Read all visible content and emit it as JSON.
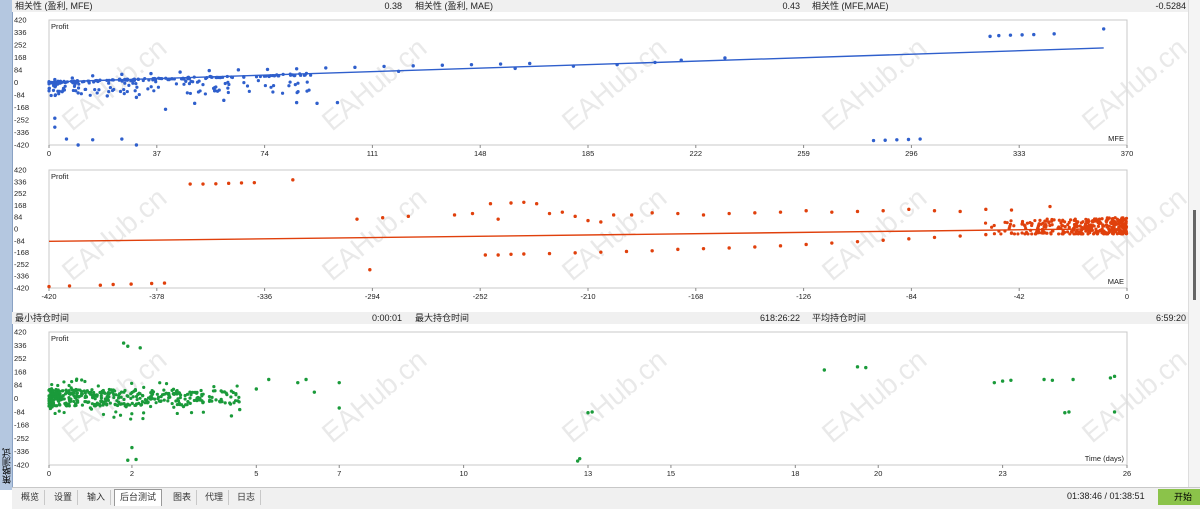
{
  "sidebar": {
    "title": "策略测试"
  },
  "row1": [
    {
      "label": "相关性 (盈利, MFE)",
      "value": "0.38"
    },
    {
      "label": "相关性 (盈利, MAE)",
      "value": "0.43"
    },
    {
      "label": "相关性 (MFE,MAE)",
      "value": "-0.5284"
    }
  ],
  "row2": [
    {
      "label": "最小持仓时间",
      "value": "0:00:01"
    },
    {
      "label": "最大持仓时间",
      "value": "618:26:22"
    },
    {
      "label": "平均持仓时间",
      "value": "6:59:20"
    }
  ],
  "watermark": "EAHub.cn",
  "colors": {
    "mfe": "#2f5fcc",
    "mae": "#e0400c",
    "time": "#1a9a3a"
  },
  "chart_data": [
    {
      "type": "scatter",
      "name": "MFE",
      "ylabel": "Profit",
      "xlabel": "MFE",
      "x_ticks": [
        "0",
        "37",
        "74",
        "111",
        "148",
        "185",
        "222",
        "259",
        "296",
        "333",
        "370"
      ],
      "y_ticks": [
        "420",
        "336",
        "252",
        "168",
        "84",
        "0",
        "-84",
        "-168",
        "-252",
        "-336",
        "-420"
      ],
      "xlim": [
        0,
        370
      ],
      "ylim": [
        -420,
        420
      ],
      "regression": [
        [
          0,
          3
        ],
        [
          362,
          232
        ]
      ],
      "points": [
        [
          120,
          75
        ],
        [
          160,
          95
        ],
        [
          180,
          110
        ],
        [
          195,
          120
        ],
        [
          208,
          135
        ],
        [
          217,
          150
        ],
        [
          232,
          165
        ],
        [
          323,
          310
        ],
        [
          326,
          315
        ],
        [
          330,
          318
        ],
        [
          334,
          320
        ],
        [
          338,
          322
        ],
        [
          345,
          327
        ],
        [
          362,
          360
        ],
        [
          283,
          -390
        ],
        [
          287,
          -388
        ],
        [
          291,
          -385
        ],
        [
          295,
          -383
        ],
        [
          299,
          -380
        ],
        [
          85,
          -135
        ],
        [
          92,
          -140
        ],
        [
          99,
          -135
        ],
        [
          2,
          -240
        ],
        [
          2,
          -300
        ],
        [
          6,
          -380
        ],
        [
          15,
          -385
        ],
        [
          25,
          -380
        ],
        [
          10,
          -420
        ],
        [
          30,
          -420
        ],
        [
          40,
          -180
        ],
        [
          50,
          -140
        ],
        [
          60,
          -120
        ],
        [
          30,
          -100
        ],
        [
          20,
          -90
        ],
        [
          10,
          -70
        ],
        [
          5,
          -40
        ],
        [
          3,
          -10
        ],
        [
          2,
          20
        ],
        [
          8,
          30
        ],
        [
          15,
          45
        ],
        [
          25,
          55
        ],
        [
          35,
          60
        ],
        [
          45,
          70
        ],
        [
          55,
          80
        ],
        [
          65,
          85
        ],
        [
          75,
          88
        ],
        [
          85,
          92
        ],
        [
          95,
          98
        ],
        [
          105,
          102
        ],
        [
          115,
          108
        ],
        [
          125,
          112
        ],
        [
          135,
          116
        ],
        [
          145,
          120
        ],
        [
          155,
          124
        ],
        [
          165,
          128
        ]
      ],
      "dense": {
        "from": 0,
        "to": 90,
        "count": 260
      }
    },
    {
      "type": "scatter",
      "name": "MAE",
      "ylabel": "Profit",
      "xlabel": "MAE",
      "x_ticks": [
        "-420",
        "-378",
        "-336",
        "-294",
        "-252",
        "-210",
        "-168",
        "-126",
        "-84",
        "-42",
        "0"
      ],
      "y_ticks": [
        "420",
        "336",
        "252",
        "168",
        "84",
        "0",
        "-84",
        "-168",
        "-252",
        "-336",
        "-420"
      ],
      "xlim": [
        -420,
        0
      ],
      "ylim": [
        -420,
        420
      ],
      "regression": [
        [
          -420,
          -88
        ],
        [
          -15,
          0
        ]
      ],
      "points": [
        [
          -420,
          -410
        ],
        [
          -412,
          -405
        ],
        [
          -400,
          -400
        ],
        [
          -395,
          -395
        ],
        [
          -388,
          -392
        ],
        [
          -380,
          -388
        ],
        [
          -375,
          -385
        ],
        [
          -365,
          320
        ],
        [
          -360,
          320
        ],
        [
          -355,
          322
        ],
        [
          -350,
          325
        ],
        [
          -345,
          328
        ],
        [
          -340,
          330
        ],
        [
          -325,
          350
        ],
        [
          -300,
          70
        ],
        [
          -290,
          80
        ],
        [
          -280,
          90
        ],
        [
          -262,
          100
        ],
        [
          -255,
          110
        ],
        [
          -248,
          180
        ],
        [
          -245,
          70
        ],
        [
          -240,
          185
        ],
        [
          -235,
          190
        ],
        [
          -230,
          180
        ],
        [
          -225,
          110
        ],
        [
          -220,
          120
        ],
        [
          -215,
          90
        ],
        [
          -210,
          60
        ],
        [
          -205,
          50
        ],
        [
          -200,
          100
        ],
        [
          -193,
          100
        ],
        [
          -185,
          115
        ],
        [
          -175,
          110
        ],
        [
          -165,
          100
        ],
        [
          -155,
          110
        ],
        [
          -145,
          115
        ],
        [
          -135,
          120
        ],
        [
          -125,
          130
        ],
        [
          -115,
          120
        ],
        [
          -105,
          125
        ],
        [
          -95,
          130
        ],
        [
          -85,
          140
        ],
        [
          -75,
          130
        ],
        [
          -65,
          125
        ],
        [
          -55,
          140
        ],
        [
          -45,
          135
        ],
        [
          -30,
          160
        ],
        [
          -295,
          -290
        ],
        [
          -250,
          -185
        ],
        [
          -245,
          -185
        ],
        [
          -240,
          -180
        ],
        [
          -235,
          -178
        ],
        [
          -225,
          -175
        ],
        [
          -215,
          -170
        ],
        [
          -205,
          -165
        ],
        [
          -195,
          -160
        ],
        [
          -185,
          -155
        ],
        [
          -175,
          -145
        ],
        [
          -165,
          -140
        ],
        [
          -155,
          -135
        ],
        [
          -145,
          -128
        ],
        [
          -135,
          -120
        ],
        [
          -125,
          -110
        ],
        [
          -115,
          -100
        ],
        [
          -105,
          -90
        ],
        [
          -95,
          -80
        ],
        [
          -85,
          -70
        ],
        [
          -75,
          -60
        ],
        [
          -65,
          -50
        ],
        [
          -55,
          -40
        ],
        [
          -45,
          -30
        ],
        [
          -35,
          -20
        ]
      ],
      "dense": {
        "from": -60,
        "to": 0,
        "count": 320
      }
    },
    {
      "type": "scatter",
      "name": "Time",
      "ylabel": "Profit",
      "xlabel": "Time (days)",
      "x_ticks": [
        "0",
        "2",
        "5",
        "7",
        "10",
        "13",
        "15",
        "18",
        "20",
        "23",
        "26"
      ],
      "y_ticks": [
        "420",
        "336",
        "252",
        "168",
        "84",
        "0",
        "-84",
        "-168",
        "-252",
        "-336",
        "-420"
      ],
      "xlim": [
        0,
        26
      ],
      "ylim": [
        -420,
        420
      ],
      "points": [
        [
          1.8,
          350
        ],
        [
          1.9,
          330
        ],
        [
          2.2,
          320
        ],
        [
          2.0,
          -310
        ],
        [
          1.9,
          -390
        ],
        [
          2.1,
          -385
        ],
        [
          12.8,
          -380
        ],
        [
          12.75,
          -395
        ],
        [
          13.0,
          -90
        ],
        [
          13.1,
          -85
        ],
        [
          18.7,
          180
        ],
        [
          19.5,
          200
        ],
        [
          19.7,
          195
        ],
        [
          22.8,
          100
        ],
        [
          23.0,
          110
        ],
        [
          23.2,
          115
        ],
        [
          24.0,
          120
        ],
        [
          24.2,
          115
        ],
        [
          24.7,
          120
        ],
        [
          24.5,
          -90
        ],
        [
          24.6,
          -85
        ],
        [
          25.6,
          130
        ],
        [
          25.7,
          140
        ],
        [
          25.7,
          -85
        ],
        [
          6.0,
          100
        ],
        [
          6.2,
          120
        ],
        [
          6.4,
          40
        ],
        [
          7.0,
          100
        ],
        [
          7.0,
          -60
        ],
        [
          5.3,
          120
        ],
        [
          5.0,
          60
        ],
        [
          4.6,
          -70
        ],
        [
          4.4,
          -110
        ],
        [
          3.4,
          40
        ],
        [
          3.2,
          -40
        ],
        [
          3.0,
          30
        ]
      ],
      "dense": {
        "from": 0,
        "to": 4.6,
        "count": 420
      }
    }
  ],
  "tabs": [
    "概览",
    "设置",
    "输入",
    "后台测试",
    "图表",
    "代理",
    "日志"
  ],
  "active_tab": "后台测试",
  "status": {
    "time": "01:38:46 / 01:38:51",
    "start_label": "开始"
  }
}
